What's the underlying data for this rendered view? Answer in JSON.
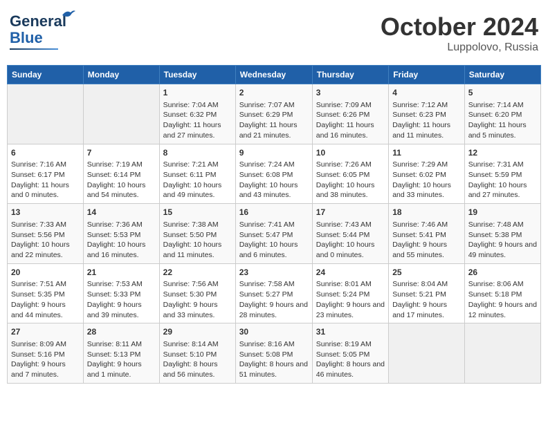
{
  "header": {
    "logo_line1": "General",
    "logo_line2": "Blue",
    "month_year": "October 2024",
    "location": "Luppolovo, Russia"
  },
  "weekdays": [
    "Sunday",
    "Monday",
    "Tuesday",
    "Wednesday",
    "Thursday",
    "Friday",
    "Saturday"
  ],
  "weeks": [
    [
      {
        "day": "",
        "info": ""
      },
      {
        "day": "",
        "info": ""
      },
      {
        "day": "1",
        "info": "Sunrise: 7:04 AM\nSunset: 6:32 PM\nDaylight: 11 hours and 27 minutes."
      },
      {
        "day": "2",
        "info": "Sunrise: 7:07 AM\nSunset: 6:29 PM\nDaylight: 11 hours and 21 minutes."
      },
      {
        "day": "3",
        "info": "Sunrise: 7:09 AM\nSunset: 6:26 PM\nDaylight: 11 hours and 16 minutes."
      },
      {
        "day": "4",
        "info": "Sunrise: 7:12 AM\nSunset: 6:23 PM\nDaylight: 11 hours and 11 minutes."
      },
      {
        "day": "5",
        "info": "Sunrise: 7:14 AM\nSunset: 6:20 PM\nDaylight: 11 hours and 5 minutes."
      }
    ],
    [
      {
        "day": "6",
        "info": "Sunrise: 7:16 AM\nSunset: 6:17 PM\nDaylight: 11 hours and 0 minutes."
      },
      {
        "day": "7",
        "info": "Sunrise: 7:19 AM\nSunset: 6:14 PM\nDaylight: 10 hours and 54 minutes."
      },
      {
        "day": "8",
        "info": "Sunrise: 7:21 AM\nSunset: 6:11 PM\nDaylight: 10 hours and 49 minutes."
      },
      {
        "day": "9",
        "info": "Sunrise: 7:24 AM\nSunset: 6:08 PM\nDaylight: 10 hours and 43 minutes."
      },
      {
        "day": "10",
        "info": "Sunrise: 7:26 AM\nSunset: 6:05 PM\nDaylight: 10 hours and 38 minutes."
      },
      {
        "day": "11",
        "info": "Sunrise: 7:29 AM\nSunset: 6:02 PM\nDaylight: 10 hours and 33 minutes."
      },
      {
        "day": "12",
        "info": "Sunrise: 7:31 AM\nSunset: 5:59 PM\nDaylight: 10 hours and 27 minutes."
      }
    ],
    [
      {
        "day": "13",
        "info": "Sunrise: 7:33 AM\nSunset: 5:56 PM\nDaylight: 10 hours and 22 minutes."
      },
      {
        "day": "14",
        "info": "Sunrise: 7:36 AM\nSunset: 5:53 PM\nDaylight: 10 hours and 16 minutes."
      },
      {
        "day": "15",
        "info": "Sunrise: 7:38 AM\nSunset: 5:50 PM\nDaylight: 10 hours and 11 minutes."
      },
      {
        "day": "16",
        "info": "Sunrise: 7:41 AM\nSunset: 5:47 PM\nDaylight: 10 hours and 6 minutes."
      },
      {
        "day": "17",
        "info": "Sunrise: 7:43 AM\nSunset: 5:44 PM\nDaylight: 10 hours and 0 minutes."
      },
      {
        "day": "18",
        "info": "Sunrise: 7:46 AM\nSunset: 5:41 PM\nDaylight: 9 hours and 55 minutes."
      },
      {
        "day": "19",
        "info": "Sunrise: 7:48 AM\nSunset: 5:38 PM\nDaylight: 9 hours and 49 minutes."
      }
    ],
    [
      {
        "day": "20",
        "info": "Sunrise: 7:51 AM\nSunset: 5:35 PM\nDaylight: 9 hours and 44 minutes."
      },
      {
        "day": "21",
        "info": "Sunrise: 7:53 AM\nSunset: 5:33 PM\nDaylight: 9 hours and 39 minutes."
      },
      {
        "day": "22",
        "info": "Sunrise: 7:56 AM\nSunset: 5:30 PM\nDaylight: 9 hours and 33 minutes."
      },
      {
        "day": "23",
        "info": "Sunrise: 7:58 AM\nSunset: 5:27 PM\nDaylight: 9 hours and 28 minutes."
      },
      {
        "day": "24",
        "info": "Sunrise: 8:01 AM\nSunset: 5:24 PM\nDaylight: 9 hours and 23 minutes."
      },
      {
        "day": "25",
        "info": "Sunrise: 8:04 AM\nSunset: 5:21 PM\nDaylight: 9 hours and 17 minutes."
      },
      {
        "day": "26",
        "info": "Sunrise: 8:06 AM\nSunset: 5:18 PM\nDaylight: 9 hours and 12 minutes."
      }
    ],
    [
      {
        "day": "27",
        "info": "Sunrise: 8:09 AM\nSunset: 5:16 PM\nDaylight: 9 hours and 7 minutes."
      },
      {
        "day": "28",
        "info": "Sunrise: 8:11 AM\nSunset: 5:13 PM\nDaylight: 9 hours and 1 minute."
      },
      {
        "day": "29",
        "info": "Sunrise: 8:14 AM\nSunset: 5:10 PM\nDaylight: 8 hours and 56 minutes."
      },
      {
        "day": "30",
        "info": "Sunrise: 8:16 AM\nSunset: 5:08 PM\nDaylight: 8 hours and 51 minutes."
      },
      {
        "day": "31",
        "info": "Sunrise: 8:19 AM\nSunset: 5:05 PM\nDaylight: 8 hours and 46 minutes."
      },
      {
        "day": "",
        "info": ""
      },
      {
        "day": "",
        "info": ""
      }
    ]
  ]
}
